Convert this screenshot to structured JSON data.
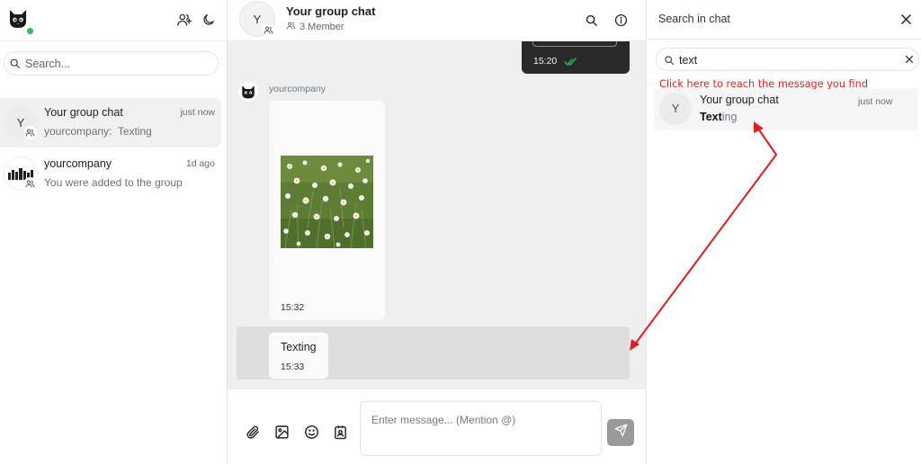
{
  "sidebar": {
    "search_placeholder": "Search...",
    "conversations": [
      {
        "avatar_letter": "Y",
        "name": "Your group chat",
        "time": "just now",
        "preview": "yourcompany:  Texting",
        "active": true
      },
      {
        "avatar_letter": "",
        "name": "yourcompany",
        "time": "1d ago",
        "preview": "You were added to the group",
        "active": false
      }
    ],
    "icons": [
      "cat-avatar-icon",
      "add-user-icon",
      "moon-icon",
      "search-icon",
      "group-icon"
    ]
  },
  "chat": {
    "avatar_letter": "Y",
    "title": "Your group chat",
    "members": "3 Member",
    "messages": [
      {
        "type": "outgoing",
        "time": "15:20",
        "status": "read"
      },
      {
        "type": "image",
        "sender": "yourcompany",
        "time": "15:32"
      },
      {
        "type": "text",
        "text": "Texting",
        "time": "15:33",
        "highlighted": true
      }
    ],
    "composer_placeholder": "Enter message... (Mention @)",
    "tools": [
      "paperclip-icon",
      "image-icon",
      "smile-icon",
      "contact-card-icon"
    ],
    "send_icon": "send-icon"
  },
  "search_panel": {
    "title": "Search in chat",
    "query": "text",
    "annotation": "Click here to reach the message you find",
    "result": {
      "avatar_letter": "Y",
      "name": "Your group chat",
      "time": "just now",
      "match": "Text",
      "rest": "ing"
    }
  },
  "colors": {
    "online": "#22c55e",
    "annotation": "#e11d1d",
    "sent_bubble": "#2a2a2a",
    "read_check": "#22c55e",
    "chat_bg": "#efefef"
  }
}
